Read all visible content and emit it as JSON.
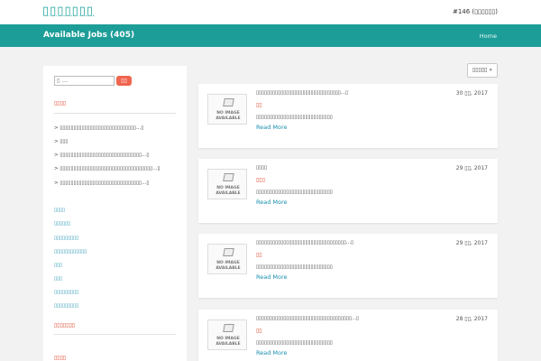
{
  "site": {
    "title": "▯▯▯▯▯▯▯",
    "top_right": "#146 (▯▯▯▯▯▯)"
  },
  "banner": {
    "title": "Available Jobs (405)",
    "home": "Home"
  },
  "sidebar": {
    "search_placeholder": "▯ ....",
    "search_button": "▯▯",
    "recent_title": "▯▯▯▯",
    "recent_items": [
      "> ▯▯▯▯▯▯▯▯▯▯▯▯▯▯▯▯▯▯▯▯▯▯▯▯▯▯▯▯...▯",
      "> ▯▯▯",
      "> ▯▯▯▯▯▯▯▯▯▯▯▯▯▯▯▯▯▯▯▯▯▯▯▯▯▯▯▯▯▯...▯",
      "> ▯▯▯▯▯▯▯▯▯▯▯▯▯▯▯▯▯▯▯▯▯▯▯▯▯▯▯▯▯▯▯▯▯▯...▯",
      "> ▯▯▯▯▯▯▯▯▯▯▯▯▯▯▯▯▯▯▯▯▯▯▯▯▯▯▯▯▯▯...▯"
    ],
    "categories": [
      "▯▯▯▯",
      "▯▯▯▯▯▯",
      "▯▯▯▯▯▯▯▯▯",
      "▯▯▯▯▯▯▯▯▯▯▯▯",
      "▯▯▯",
      "▯▯▯",
      "▯▯▯▯▯▯▯▯▯",
      "▯▯▯▯▯▯▯▯▯"
    ],
    "second_title": "▯▯▯▯▯▯▯",
    "third_title": "▯▯▯▯"
  },
  "sort_label": "▯▯▯▯▯ »",
  "jobs": [
    {
      "title": "▯▯▯▯▯▯▯▯▯▯▯▯▯▯▯▯▯▯▯▯▯▯▯▯▯▯▯▯▯▯▯...▯",
      "date": "30 ▯▯, 2017",
      "badge": "▯▯",
      "desc": "▯▯▯▯▯▯▯▯▯▯▯▯▯▯▯▯▯▯▯▯▯▯▯▯▯▯▯▯",
      "read_more": "Read More"
    },
    {
      "title": "▯▯▯▯",
      "date": "29 ▯▯, 2017",
      "badge": "▯▯▯",
      "desc": "▯▯▯▯▯▯▯▯▯▯▯▯▯▯▯▯▯▯▯▯▯▯▯▯▯▯▯▯",
      "read_more": "Read More"
    },
    {
      "title": "▯▯▯▯▯▯▯▯▯▯▯▯▯▯▯▯▯▯▯▯▯▯▯▯▯▯▯▯▯▯▯▯▯...▯",
      "date": "29 ▯▯, 2017",
      "badge": "▯▯",
      "desc": "▯▯▯▯▯▯▯▯▯▯▯▯▯▯▯▯▯▯▯▯▯▯▯▯▯▯▯▯",
      "read_more": "Read More"
    },
    {
      "title": "▯▯▯▯▯▯▯▯▯▯▯▯▯▯▯▯▯▯▯▯▯▯▯▯▯▯▯▯▯▯▯▯▯▯▯...▯",
      "date": "28 ▯▯, 2017",
      "badge": "▯▯",
      "desc": "▯▯▯▯▯▯▯▯▯▯▯▯▯▯▯▯▯▯▯▯▯▯▯▯▯▯▯▯",
      "read_more": "Read More"
    }
  ],
  "no_image": {
    "line1": "NO IMAGE",
    "line2": "AVAILABLE"
  },
  "colors": {
    "accent": "#1d9d98",
    "badge": "#e0492f",
    "link": "#1a8fb0",
    "search_button": "#f0654f"
  }
}
